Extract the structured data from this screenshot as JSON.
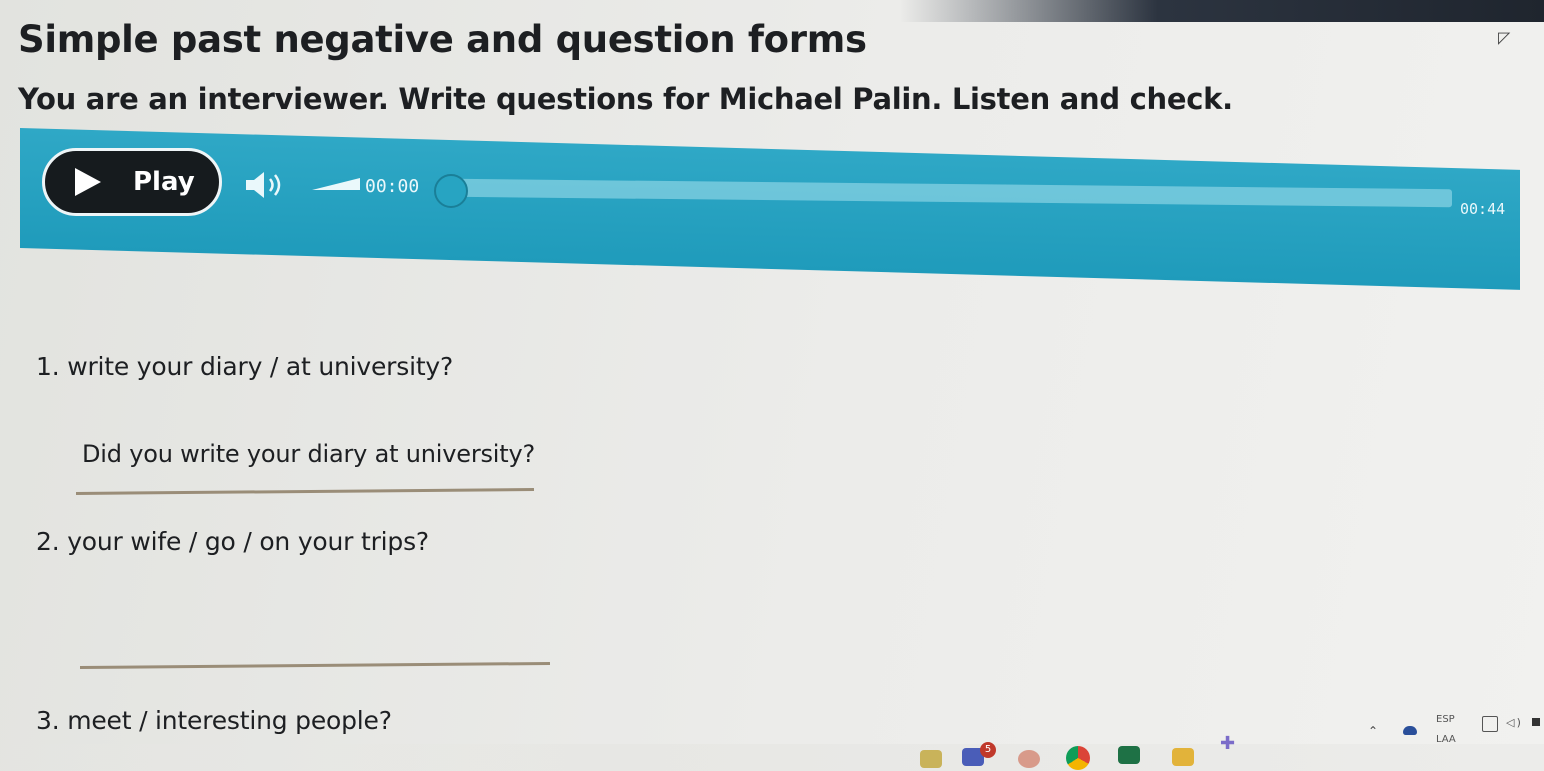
{
  "header": {
    "title": "Simple past negative and question forms",
    "instruction": "You are an interviewer. Write questions for Michael Palin. Listen and check."
  },
  "player": {
    "play_label": "Play",
    "current_time": "00:00",
    "total_time": "00:44",
    "progress_fraction": 0.0,
    "accent_color": "#1f9bbb"
  },
  "questions": [
    {
      "prompt": "1.  write your diary / at university?",
      "answer": "Did you write your diary at university?"
    },
    {
      "prompt": "2.  your wife / go / on your trips?",
      "answer": ""
    },
    {
      "prompt": "3.  meet / interesting people?",
      "answer": ""
    }
  ],
  "taskbar": {
    "badge_count": "5",
    "language_top": "ESP",
    "language_bottom": "LAA",
    "icons": [
      "teams-icon",
      "paint-icon",
      "chrome-icon",
      "excel-icon",
      "files-icon",
      "cursor-icon"
    ]
  }
}
